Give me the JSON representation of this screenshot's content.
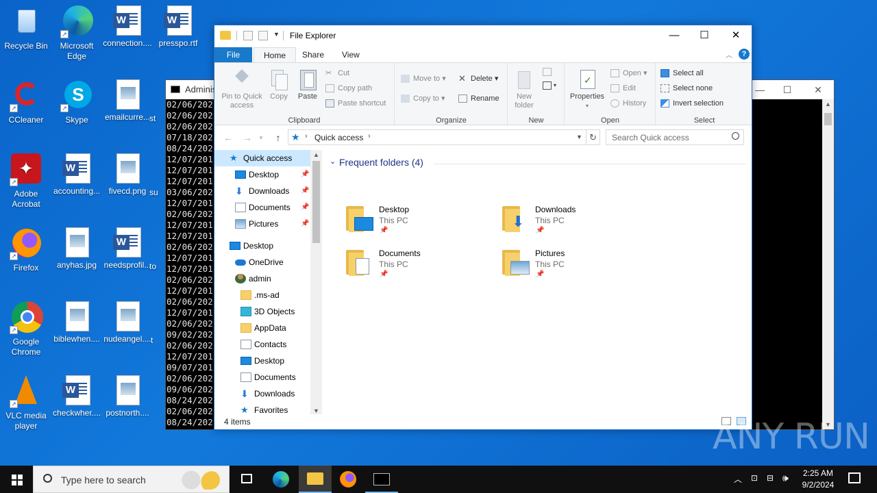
{
  "desktop": {
    "icons": [
      {
        "label": "Recycle Bin",
        "icon": "recycle-bin-icon"
      },
      {
        "label": "Microsoft Edge",
        "icon": "edge-icon"
      },
      {
        "label": "connection....",
        "icon": "word-doc-icon"
      },
      {
        "label": "presspo.rtf",
        "icon": "word-doc-icon"
      },
      {
        "label": "CCleaner",
        "icon": "ccleaner-icon"
      },
      {
        "label": "Skype",
        "icon": "skype-icon"
      },
      {
        "label": "emailcurre...",
        "icon": "image-file-icon"
      },
      {
        "label": "Adobe Acrobat",
        "icon": "acrobat-icon"
      },
      {
        "label": "accounting...",
        "icon": "word-doc-icon"
      },
      {
        "label": "fivecd.png",
        "icon": "image-file-icon"
      },
      {
        "label": "Firefox",
        "icon": "firefox-icon"
      },
      {
        "label": "anyhas.jpg",
        "icon": "image-file-icon"
      },
      {
        "label": "needsprofil...",
        "icon": "word-doc-icon"
      },
      {
        "label": "Google Chrome",
        "icon": "chrome-icon"
      },
      {
        "label": "biblewhen....",
        "icon": "image-file-icon"
      },
      {
        "label": "nudeangel....",
        "icon": "image-file-icon"
      },
      {
        "label": "VLC media player",
        "icon": "vlc-icon"
      },
      {
        "label": "checkwher....",
        "icon": "word-doc-icon"
      },
      {
        "label": "postnorth....",
        "icon": "image-file-icon"
      }
    ]
  },
  "console": {
    "title": "Adminis",
    "lines": [
      "02/06/202",
      "02/06/202",
      "02/06/202",
      "07/18/202",
      "08/24/202",
      "12/07/201",
      "12/07/201",
      "12/07/201",
      "03/06/202",
      "12/07/201",
      "02/06/202",
      "12/07/201",
      "12/07/201",
      "02/06/202",
      "12/07/201",
      "12/07/201",
      "02/06/202",
      "12/07/201",
      "02/06/202",
      "12/07/201",
      "02/06/202",
      "09/02/202",
      "02/06/202",
      "12/07/201",
      "09/07/201",
      "02/06/202",
      "09/06/202",
      "08/24/202",
      "02/06/202",
      "08/24/202"
    ],
    "partial_labels": [
      "st",
      "su",
      "to",
      "t"
    ]
  },
  "explorer": {
    "title": "File Explorer",
    "tabs": [
      "File",
      "Home",
      "Share",
      "View"
    ],
    "ribbon": {
      "clipboard": {
        "label": "Clipboard",
        "pin": "Pin to Quick access",
        "copy": "Copy",
        "paste": "Paste",
        "cut": "Cut",
        "copy_path": "Copy path",
        "paste_shortcut": "Paste shortcut"
      },
      "organize": {
        "label": "Organize",
        "move_to": "Move to",
        "copy_to": "Copy to",
        "delete": "Delete",
        "rename": "Rename"
      },
      "new": {
        "label": "New",
        "new_folder": "New folder"
      },
      "open": {
        "label": "Open",
        "properties": "Properties",
        "open": "Open",
        "edit": "Edit",
        "history": "History"
      },
      "select": {
        "label": "Select",
        "select_all": "Select all",
        "select_none": "Select none",
        "invert": "Invert selection"
      }
    },
    "address": {
      "crumb": "Quick access",
      "search_placeholder": "Search Quick access"
    },
    "nav": [
      {
        "label": "Quick access",
        "icon": "star-icon",
        "selected": true
      },
      {
        "label": "Desktop",
        "icon": "desktop-icon",
        "pinned": true
      },
      {
        "label": "Downloads",
        "icon": "download-icon",
        "pinned": true
      },
      {
        "label": "Documents",
        "icon": "documents-icon",
        "pinned": true
      },
      {
        "label": "Pictures",
        "icon": "pictures-icon",
        "pinned": true
      },
      {
        "label": "Desktop",
        "icon": "desktop-icon"
      },
      {
        "label": "OneDrive",
        "icon": "cloud-icon"
      },
      {
        "label": "admin",
        "icon": "user-icon"
      },
      {
        "label": ".ms-ad",
        "icon": "folder-icon"
      },
      {
        "label": "3D Objects",
        "icon": "cube-icon"
      },
      {
        "label": "AppData",
        "icon": "folder-icon"
      },
      {
        "label": "Contacts",
        "icon": "contacts-icon"
      },
      {
        "label": "Desktop",
        "icon": "desktop-icon"
      },
      {
        "label": "Documents",
        "icon": "documents-icon"
      },
      {
        "label": "Downloads",
        "icon": "download-icon"
      },
      {
        "label": "Favorites",
        "icon": "star-icon"
      }
    ],
    "group_header": "Frequent folders (4)",
    "folders": [
      {
        "name": "Desktop",
        "location": "This PC"
      },
      {
        "name": "Downloads",
        "location": "This PC"
      },
      {
        "name": "Documents",
        "location": "This PC"
      },
      {
        "name": "Pictures",
        "location": "This PC"
      }
    ],
    "status": "4 items"
  },
  "taskbar": {
    "search_placeholder": "Type here to search",
    "time": "2:25 AM",
    "date": "9/2/2024"
  },
  "watermark": "ANY RUN",
  "colors": {
    "accent": "#1979ca",
    "selection": "#cce8ff",
    "desktop": "#0b63c9"
  }
}
